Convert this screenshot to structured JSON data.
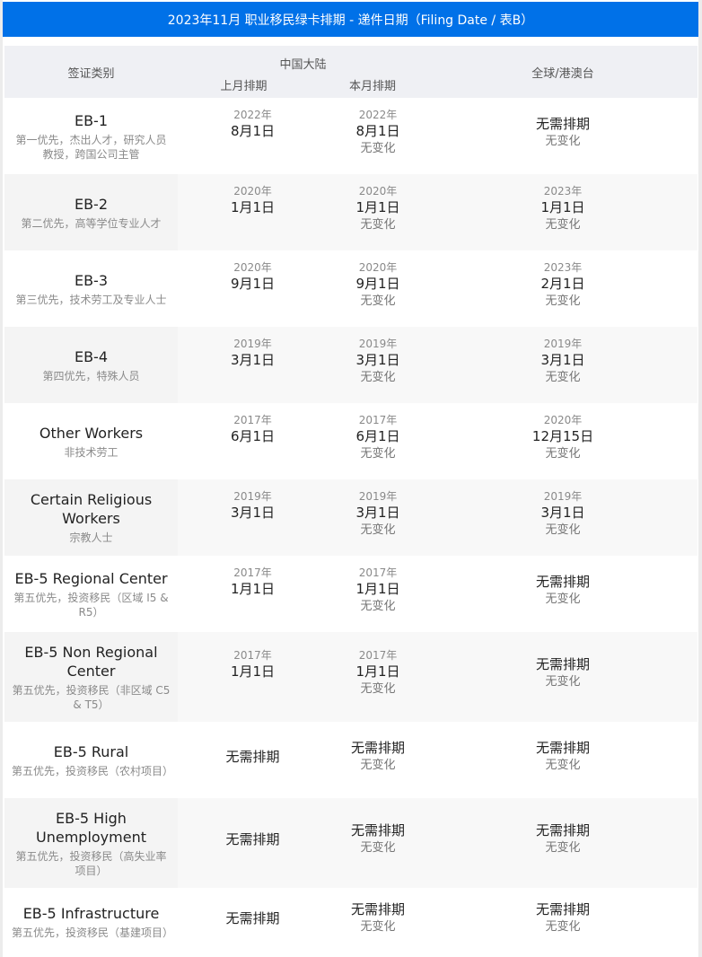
{
  "title": "2023年11月 职业移民绿卡排期 - 递件日期（Filing Date / 表B）",
  "header": {
    "category": "签证类别",
    "china": "中国大陆",
    "last_month": "上月排期",
    "this_month": "本月排期",
    "global": "全球/港澳台"
  },
  "rows": [
    {
      "name": "EB-1",
      "desc": "第一优先，杰出人才，研究人员 教授，跨国公司主管",
      "prev": {
        "year": "2022年",
        "date": "8月1日"
      },
      "curr": {
        "year": "2022年",
        "date": "8月1日",
        "change": "无变化"
      },
      "global": {
        "year": "",
        "date": "无需排期",
        "change": "无变化"
      }
    },
    {
      "name": "EB-2",
      "desc": "第二优先，高等学位专业人才",
      "prev": {
        "year": "2020年",
        "date": "1月1日"
      },
      "curr": {
        "year": "2020年",
        "date": "1月1日",
        "change": "无变化"
      },
      "global": {
        "year": "2023年",
        "date": "1月1日",
        "change": "无变化"
      }
    },
    {
      "name": "EB-3",
      "desc": "第三优先，技术劳工及专业人士",
      "prev": {
        "year": "2020年",
        "date": "9月1日"
      },
      "curr": {
        "year": "2020年",
        "date": "9月1日",
        "change": "无变化"
      },
      "global": {
        "year": "2023年",
        "date": "2月1日",
        "change": "无变化"
      }
    },
    {
      "name": "EB-4",
      "desc": "第四优先，特殊人员",
      "prev": {
        "year": "2019年",
        "date": "3月1日"
      },
      "curr": {
        "year": "2019年",
        "date": "3月1日",
        "change": "无变化"
      },
      "global": {
        "year": "2019年",
        "date": "3月1日",
        "change": "无变化"
      }
    },
    {
      "name": "Other Workers",
      "desc": "非技术劳工",
      "prev": {
        "year": "2017年",
        "date": "6月1日"
      },
      "curr": {
        "year": "2017年",
        "date": "6月1日",
        "change": "无变化"
      },
      "global": {
        "year": "2020年",
        "date": "12月15日",
        "change": "无变化"
      }
    },
    {
      "name": "Certain Religious Workers",
      "desc": "宗教人士",
      "prev": {
        "year": "2019年",
        "date": "3月1日"
      },
      "curr": {
        "year": "2019年",
        "date": "3月1日",
        "change": "无变化"
      },
      "global": {
        "year": "2019年",
        "date": "3月1日",
        "change": "无变化"
      }
    },
    {
      "name": "EB-5 Regional Center",
      "desc": "第五优先，投资移民（区域 I5 & R5）",
      "prev": {
        "year": "2017年",
        "date": "1月1日"
      },
      "curr": {
        "year": "2017年",
        "date": "1月1日",
        "change": "无变化"
      },
      "global": {
        "year": "",
        "date": "无需排期",
        "change": "无变化"
      }
    },
    {
      "name": "EB-5 Non Regional Center",
      "desc": "第五优先，投资移民（非区域 C5 & T5）",
      "prev": {
        "year": "2017年",
        "date": "1月1日"
      },
      "curr": {
        "year": "2017年",
        "date": "1月1日",
        "change": "无变化"
      },
      "global": {
        "year": "",
        "date": "无需排期",
        "change": "无变化"
      }
    },
    {
      "name": "EB-5 Rural",
      "desc": "第五优先，投资移民（农村项目）",
      "prev": {
        "year": "",
        "date": "无需排期"
      },
      "curr": {
        "year": "",
        "date": "无需排期",
        "change": "无变化"
      },
      "global": {
        "year": "",
        "date": "无需排期",
        "change": "无变化"
      }
    },
    {
      "name": "EB-5 High Unemployment",
      "desc": "第五优先，投资移民（高失业率项目）",
      "prev": {
        "year": "",
        "date": "无需排期"
      },
      "curr": {
        "year": "",
        "date": "无需排期",
        "change": "无变化"
      },
      "global": {
        "year": "",
        "date": "无需排期",
        "change": "无变化"
      }
    },
    {
      "name": "EB-5 Infrastructure",
      "desc": "第五优先，投资移民（基建项目）",
      "prev": {
        "year": "",
        "date": "无需排期"
      },
      "curr": {
        "year": "",
        "date": "无需排期",
        "change": "无变化"
      },
      "global": {
        "year": "",
        "date": "无需排期",
        "change": "无变化"
      }
    }
  ]
}
